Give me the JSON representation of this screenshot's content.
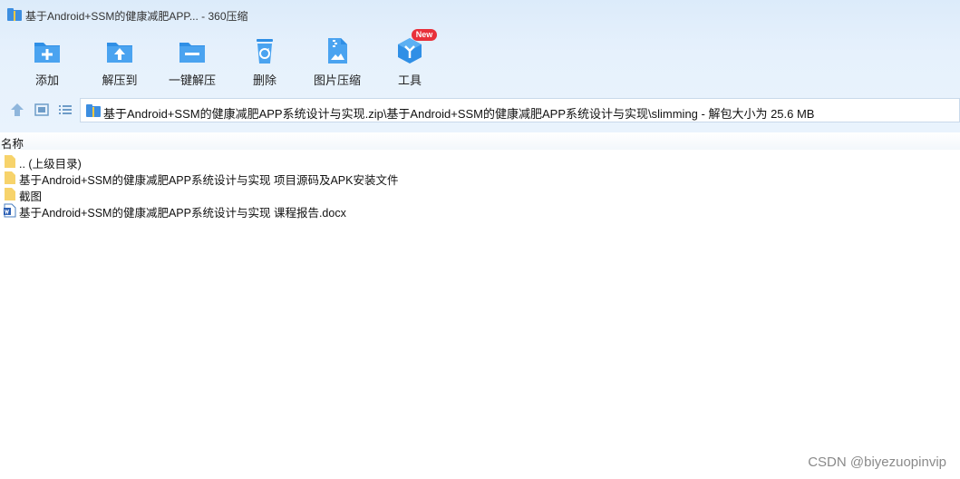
{
  "window": {
    "title": "基于Android+SSM的健康减肥APP... - 360压缩"
  },
  "toolbar": {
    "items": [
      {
        "label": "添加",
        "icon": "add-folder-icon"
      },
      {
        "label": "解压到",
        "icon": "extract-to-folder-icon"
      },
      {
        "label": "一键解压",
        "icon": "one-click-extract-icon"
      },
      {
        "label": "删除",
        "icon": "recycle-bin-icon"
      },
      {
        "label": "图片压缩",
        "icon": "image-compress-icon"
      },
      {
        "label": "工具",
        "icon": "tools-cube-icon",
        "badge": "New"
      }
    ]
  },
  "nav": {
    "address": "基于Android+SSM的健康减肥APP系统设计与实现.zip\\基于Android+SSM的健康减肥APP系统设计与实现\\slimming - 解包大小为 25.6 MB"
  },
  "list": {
    "column_name": "名称",
    "rows": [
      {
        "name": ".. (上级目录)",
        "type": "folder"
      },
      {
        "name": "基于Android+SSM的健康减肥APP系统设计与实现 项目源码及APK安装文件",
        "type": "folder"
      },
      {
        "name": "截图",
        "type": "folder"
      },
      {
        "name": "基于Android+SSM的健康减肥APP系统设计与实现 课程报告.docx",
        "type": "docx"
      }
    ]
  },
  "watermark": "CSDN @biyezuopinvip",
  "colors": {
    "accent": "#2f8fe6",
    "folder": "#f7d36b",
    "badge": "#e8303a"
  }
}
